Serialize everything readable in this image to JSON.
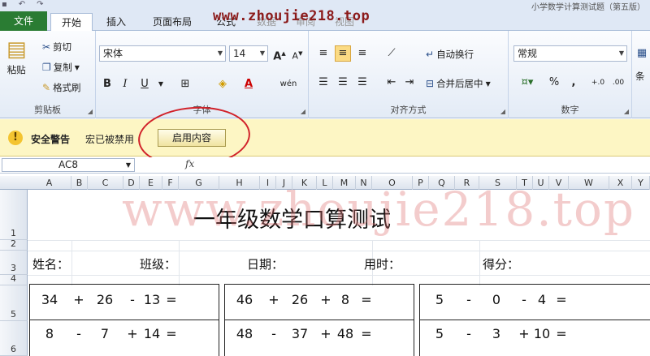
{
  "window": {
    "doc_title": "小学数学计算测试题（第五版）",
    "watermark_url": "www.zhoujie218.top"
  },
  "tabs": [
    "文件",
    "开始",
    "插入",
    "页面布局",
    "公式",
    "数据",
    "审阅",
    "视图"
  ],
  "ribbon": {
    "clipboard": {
      "paste": "粘贴",
      "cut": "剪切",
      "copy": "复制",
      "format_painter": "格式刷",
      "label": "剪贴板"
    },
    "font": {
      "name": "宋体",
      "size": "14",
      "label": "字体",
      "bold": "B",
      "italic": "I",
      "underline": "U",
      "grow": "A",
      "shrink": "A",
      "phonetic": "wén"
    },
    "alignment": {
      "wrap": "自动换行",
      "merge": "合并后居中",
      "label": "对齐方式"
    },
    "number": {
      "format": "常规",
      "percent": "%",
      "comma": ",",
      "label": "数字",
      "inc_decimal": "+.0",
      "dec_decimal": ".00"
    },
    "styles": {
      "conditional": "条"
    }
  },
  "security_bar": {
    "title": "安全警告",
    "message": "宏已被禁用",
    "enable_button": "启用内容"
  },
  "formula_bar": {
    "name_box": "AC8",
    "fx": "fx",
    "formula": ""
  },
  "columns": [
    "A",
    "B",
    "C",
    "D",
    "E",
    "F",
    "G",
    "H",
    "I",
    "J",
    "K",
    "L",
    "M",
    "N",
    "O",
    "P",
    "Q",
    "R",
    "S",
    "T",
    "U",
    "V",
    "W",
    "X",
    "Y"
  ],
  "rows": [
    "1",
    "2",
    "3",
    "4",
    "5",
    "6"
  ],
  "sheet": {
    "title": "一年级数学口算测试",
    "fields": [
      "姓名：",
      "班级：",
      "日期：",
      "用时：",
      "得分："
    ],
    "problems": [
      [
        [
          "34",
          "+",
          "26",
          "-",
          "13",
          "="
        ],
        [
          "46",
          "+",
          "26",
          "+",
          "8",
          "="
        ],
        [
          "5",
          "-",
          "0",
          "-",
          "4",
          "="
        ]
      ],
      [
        [
          "8",
          "-",
          "7",
          "+",
          "14",
          "="
        ],
        [
          "48",
          "-",
          "37",
          "+",
          "48",
          "="
        ],
        [
          "5",
          "-",
          "3",
          "+",
          "10",
          "="
        ]
      ]
    ]
  }
}
